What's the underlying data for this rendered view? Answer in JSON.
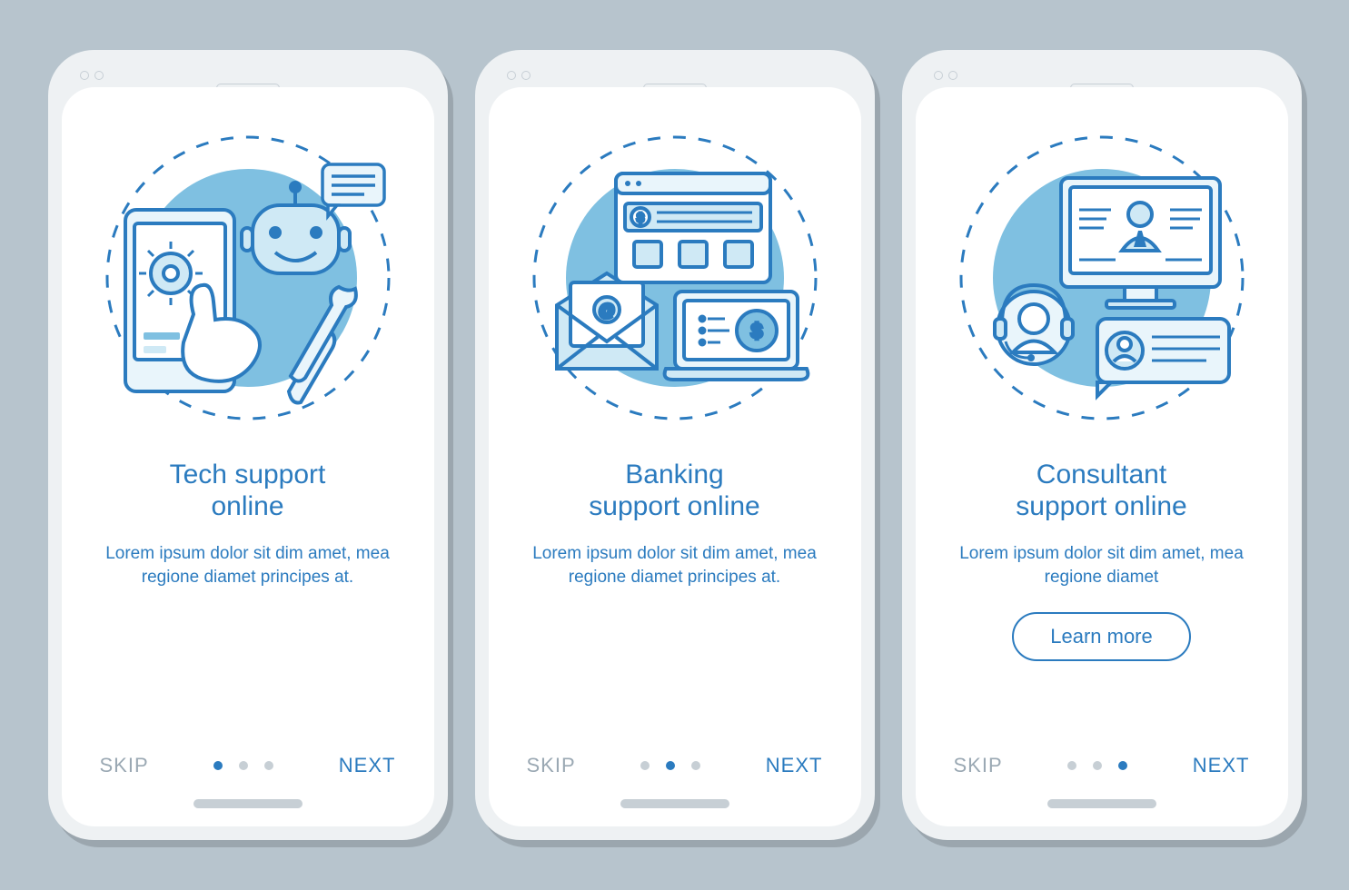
{
  "colors": {
    "primary": "#2b7bbf",
    "muted": "#9aa8b3",
    "pageBg": "#b7c4cd"
  },
  "common": {
    "skip": "SKIP",
    "next": "NEXT"
  },
  "screens": [
    {
      "title": "Tech support\nonline",
      "body": "Lorem ipsum dolor sit dim amet, mea regione diamet principes at.",
      "activeDot": 0,
      "hasLearnMore": false,
      "illustration": "tech-support"
    },
    {
      "title": "Banking\nsupport online",
      "body": "Lorem ipsum dolor sit dim amet, mea regione diamet principes at.",
      "activeDot": 1,
      "hasLearnMore": false,
      "illustration": "banking-support"
    },
    {
      "title": "Consultant\nsupport online",
      "body": "Lorem ipsum dolor sit dim amet, mea regione diamet",
      "activeDot": 2,
      "hasLearnMore": true,
      "learnMore": "Learn more",
      "illustration": "consultant-support"
    }
  ]
}
